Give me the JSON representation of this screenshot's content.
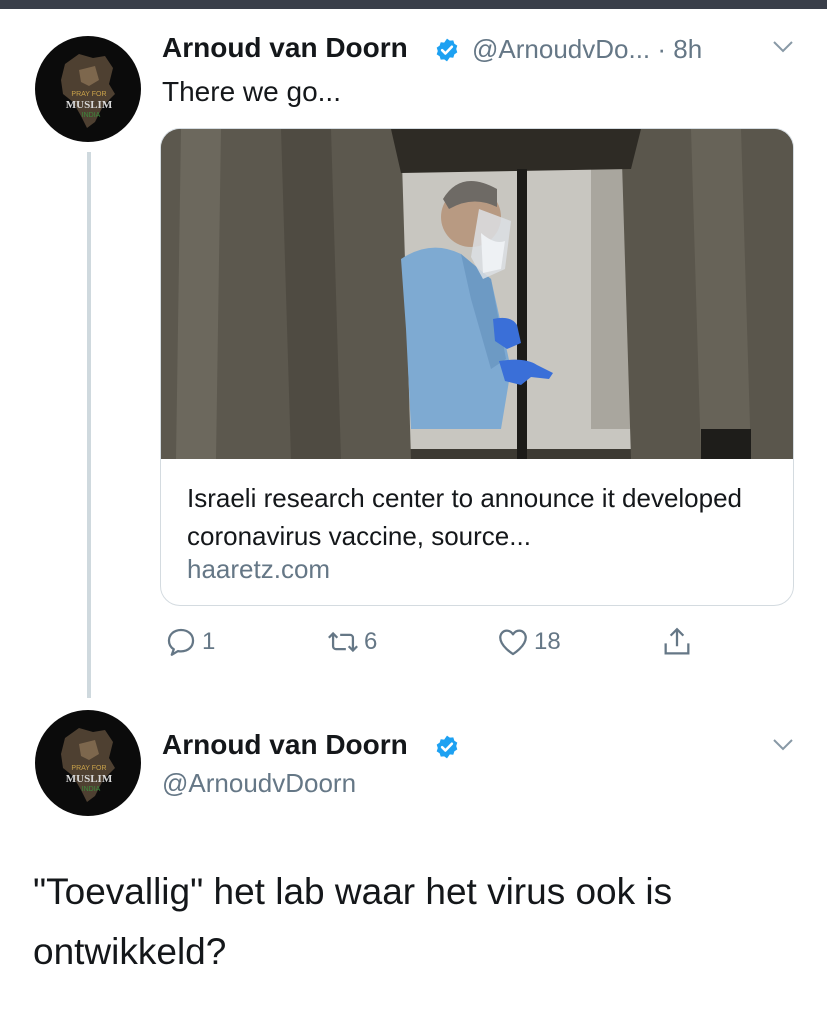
{
  "tweet1": {
    "author_name": "Arnoud van Doorn",
    "handle_time": "@ArnoudvDo... · 8h",
    "text": "There we go...",
    "avatar_text": [
      "PRAY FOR",
      "MUSLIM",
      "INDIA"
    ],
    "card": {
      "title": "Israeli research center to announce it developed coronavirus vaccine, source...",
      "domain": "haaretz.com"
    },
    "actions": {
      "replies": "1",
      "retweets": "6",
      "likes": "18"
    }
  },
  "tweet2": {
    "author_name": "Arnoud van Doorn",
    "handle": "@ArnoudvDoorn",
    "avatar_text": [
      "PRAY FOR",
      "MUSLIM",
      "INDIA"
    ],
    "text": "\"Toevallig\" het lab waar het virus ook is ontwikkeld?"
  },
  "colors": {
    "verified": "#1da1f2",
    "secondary_text": "#657786",
    "thread_line": "#cfd9de"
  },
  "icons": [
    "verified-badge-icon",
    "chevron-down-icon",
    "reply-icon",
    "retweet-icon",
    "like-icon",
    "share-icon"
  ]
}
